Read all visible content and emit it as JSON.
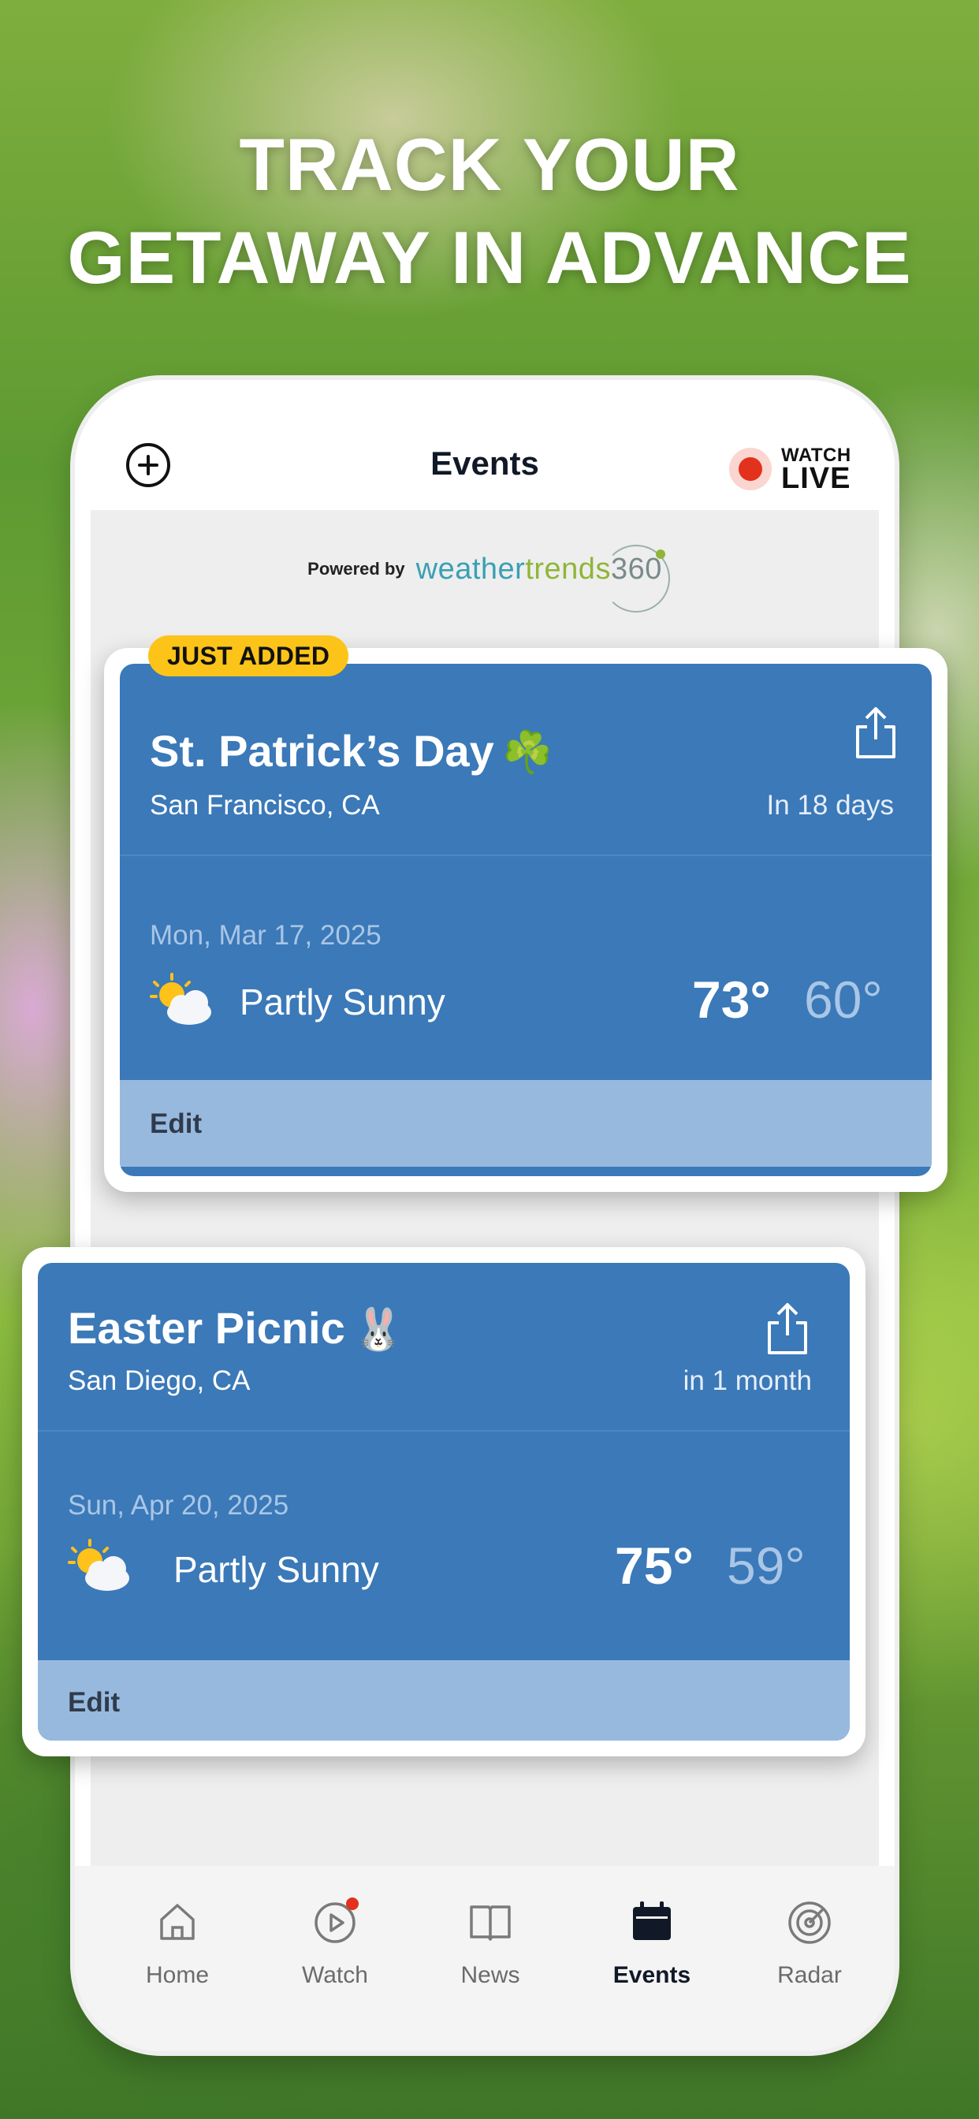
{
  "headline": {
    "line1": "TRACK YOUR",
    "line2": "GETAWAY IN ADVANCE"
  },
  "header": {
    "title": "Events",
    "add_icon": "plus-circle-icon",
    "watch_word": "WATCH",
    "live_word": "LIVE"
  },
  "powered": {
    "prefix": "Powered by",
    "brand_part1": "weather",
    "brand_part2": "trends",
    "brand_part3": "360"
  },
  "badge": {
    "just_added": "JUST ADDED"
  },
  "events": [
    {
      "title": "St. Patrick’s Day",
      "emoji": "☘️",
      "location": "San Francisco, CA",
      "when": "In 18 days",
      "date": "Mon, Mar 17, 2025",
      "condition": "Partly Sunny",
      "high": "73°",
      "low": "60°",
      "edit": "Edit",
      "icon": "partly-sunny-icon"
    },
    {
      "title": "Easter Picnic",
      "emoji": "🐰",
      "location": "San Diego, CA",
      "when": "in 1 month",
      "date": "Sun, Apr 20, 2025",
      "condition": "Partly Sunny",
      "high": "75°",
      "low": "59°",
      "edit": "Edit",
      "icon": "partly-sunny-icon"
    }
  ],
  "tabs": [
    {
      "label": "Home",
      "icon": "home-icon",
      "active": false
    },
    {
      "label": "Watch",
      "icon": "play-circle-icon",
      "active": false
    },
    {
      "label": "News",
      "icon": "book-icon",
      "active": false
    },
    {
      "label": "Events",
      "icon": "calendar-icon",
      "active": true
    },
    {
      "label": "Radar",
      "icon": "radar-icon",
      "active": false
    }
  ],
  "colors": {
    "card_blue": "#3b79b8",
    "edit_bar": "#98b9de",
    "badge_yellow": "#fcc419",
    "live_red": "#e2311d"
  }
}
